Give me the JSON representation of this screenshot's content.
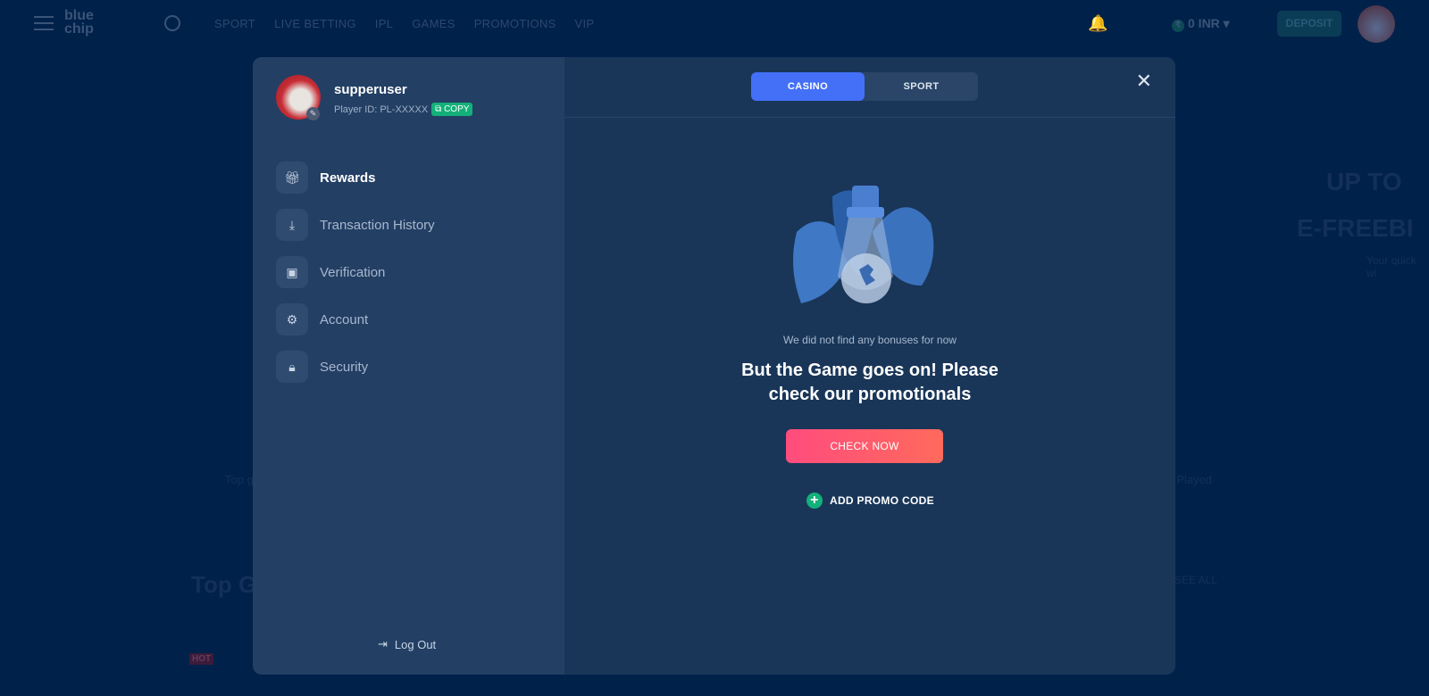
{
  "topbar": {
    "logo": "blue chip",
    "nav": [
      "SPORT",
      "LIVE BETTING",
      "IPL",
      "GAMES",
      "PROMOTIONS",
      "VIP"
    ],
    "balance": "0 INR",
    "currency_symbol": "₹",
    "deposit": "DEPOSIT"
  },
  "background": {
    "banner_line1": "UP TO",
    "banner_line2": "E-FREEBI",
    "banner_sub": "Your quick wi",
    "tab_left": "Top g",
    "tab_right": "t Played",
    "section_title": "Top G",
    "see_all": "SEE ALL",
    "hot_badge": "HOT"
  },
  "profile": {
    "username": "supperuser",
    "player_id": "Player ID: PL-XXXXX",
    "copy": "COPY"
  },
  "menu": [
    {
      "label": "Rewards",
      "icon": "gift-icon"
    },
    {
      "label": "Transaction History",
      "icon": "download-box-icon"
    },
    {
      "label": "Verification",
      "icon": "id-card-check-icon"
    },
    {
      "label": "Account",
      "icon": "gear-icon"
    },
    {
      "label": "Security",
      "icon": "lock-icon"
    }
  ],
  "logout": "Log Out",
  "tabs": [
    "CASINO",
    "SPORT"
  ],
  "active_tab": "CASINO",
  "empty": {
    "message": "We did not find any bonuses for now",
    "headline_1": "But the Game goes on! Please",
    "headline_2": "check our promotionals",
    "cta": "CHECK NOW",
    "promo": "ADD PROMO CODE"
  },
  "colors": {
    "accent": "#4470f8",
    "copy": "#14b07a",
    "cta_start": "#ff4c7d",
    "cta_end": "#ff6a5c"
  }
}
